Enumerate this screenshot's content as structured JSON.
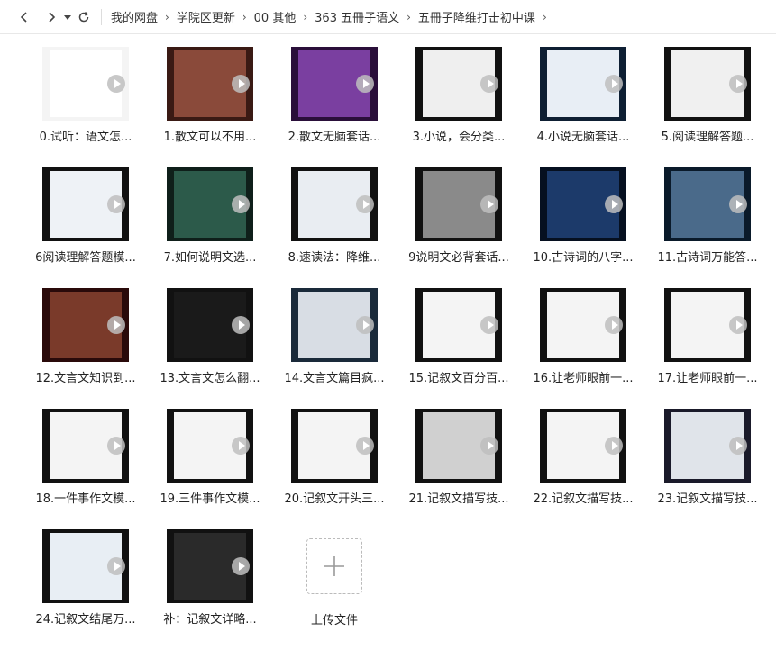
{
  "toolbar": {
    "back_icon": "chevron-left-icon",
    "forward_icon": "chevron-right-icon",
    "history_icon": "caret-down-icon",
    "refresh_icon": "refresh-icon"
  },
  "breadcrumb": [
    "我的网盘",
    "学院区更新",
    "00 其他",
    "363 五冊子语文",
    "五冊子降维打击初中课"
  ],
  "files": [
    {
      "name": "0.试听：语文怎...",
      "bg": "#f4f4f4",
      "inner": "#ffffff"
    },
    {
      "name": "1.散文可以不用...",
      "bg": "#3a1a14",
      "inner": "#8a4a3a"
    },
    {
      "name": "2.散文无脑套话...",
      "bg": "#2a0f3a",
      "inner": "#7a3fa0"
    },
    {
      "name": "3.小说，会分类...",
      "bg": "#111111",
      "inner": "#efefef"
    },
    {
      "name": "4.小说无脑套话...",
      "bg": "#0e1f33",
      "inner": "#e8eef5"
    },
    {
      "name": "5.阅读理解答题...",
      "bg": "#111111",
      "inner": "#f0f0f0"
    },
    {
      "name": "6阅读理解答题模...",
      "bg": "#111111",
      "inner": "#eef2f6"
    },
    {
      "name": "7.如何说明文选...",
      "bg": "#0f1f1a",
      "inner": "#2c5a4a"
    },
    {
      "name": "8.速读法：降维...",
      "bg": "#111111",
      "inner": "#e9edf2"
    },
    {
      "name": "9说明文必背套话...",
      "bg": "#111111",
      "inner": "#8a8a8a"
    },
    {
      "name": "10.古诗词的八字...",
      "bg": "#061020",
      "inner": "#1c3a6a"
    },
    {
      "name": "11.古诗词万能答...",
      "bg": "#0a1a2a",
      "inner": "#4a6a8a"
    },
    {
      "name": "12.文言文知识到...",
      "bg": "#2a0a0a",
      "inner": "#7a3a2a"
    },
    {
      "name": "13.文言文怎么翻...",
      "bg": "#111111",
      "inner": "#1a1a1a"
    },
    {
      "name": "14.文言文篇目疯...",
      "bg": "#1a2a3a",
      "inner": "#d8dde4"
    },
    {
      "name": "15.记叙文百分百...",
      "bg": "#111111",
      "inner": "#f4f4f4"
    },
    {
      "name": "16.让老师眼前一...",
      "bg": "#111111",
      "inner": "#f4f4f4"
    },
    {
      "name": "17.让老师眼前一...",
      "bg": "#111111",
      "inner": "#f4f4f4"
    },
    {
      "name": "18.一件事作文模...",
      "bg": "#111111",
      "inner": "#f4f4f4"
    },
    {
      "name": "19.三件事作文模...",
      "bg": "#111111",
      "inner": "#f4f4f4"
    },
    {
      "name": "20.记叙文开头三...",
      "bg": "#111111",
      "inner": "#f4f4f4"
    },
    {
      "name": "21.记叙文描写技...",
      "bg": "#111111",
      "inner": "#d0d0d0"
    },
    {
      "name": "22.记叙文描写技...",
      "bg": "#111111",
      "inner": "#f4f4f4"
    },
    {
      "name": "23.记叙文描写技...",
      "bg": "#1a1a2a",
      "inner": "#e0e4ea"
    },
    {
      "name": "24.记叙文结尾万...",
      "bg": "#111111",
      "inner": "#e8eef4"
    },
    {
      "name": "补：记叙文详略...",
      "bg": "#111111",
      "inner": "#2a2a2a"
    }
  ],
  "upload": {
    "label": "上传文件",
    "icon": "plus-icon"
  }
}
